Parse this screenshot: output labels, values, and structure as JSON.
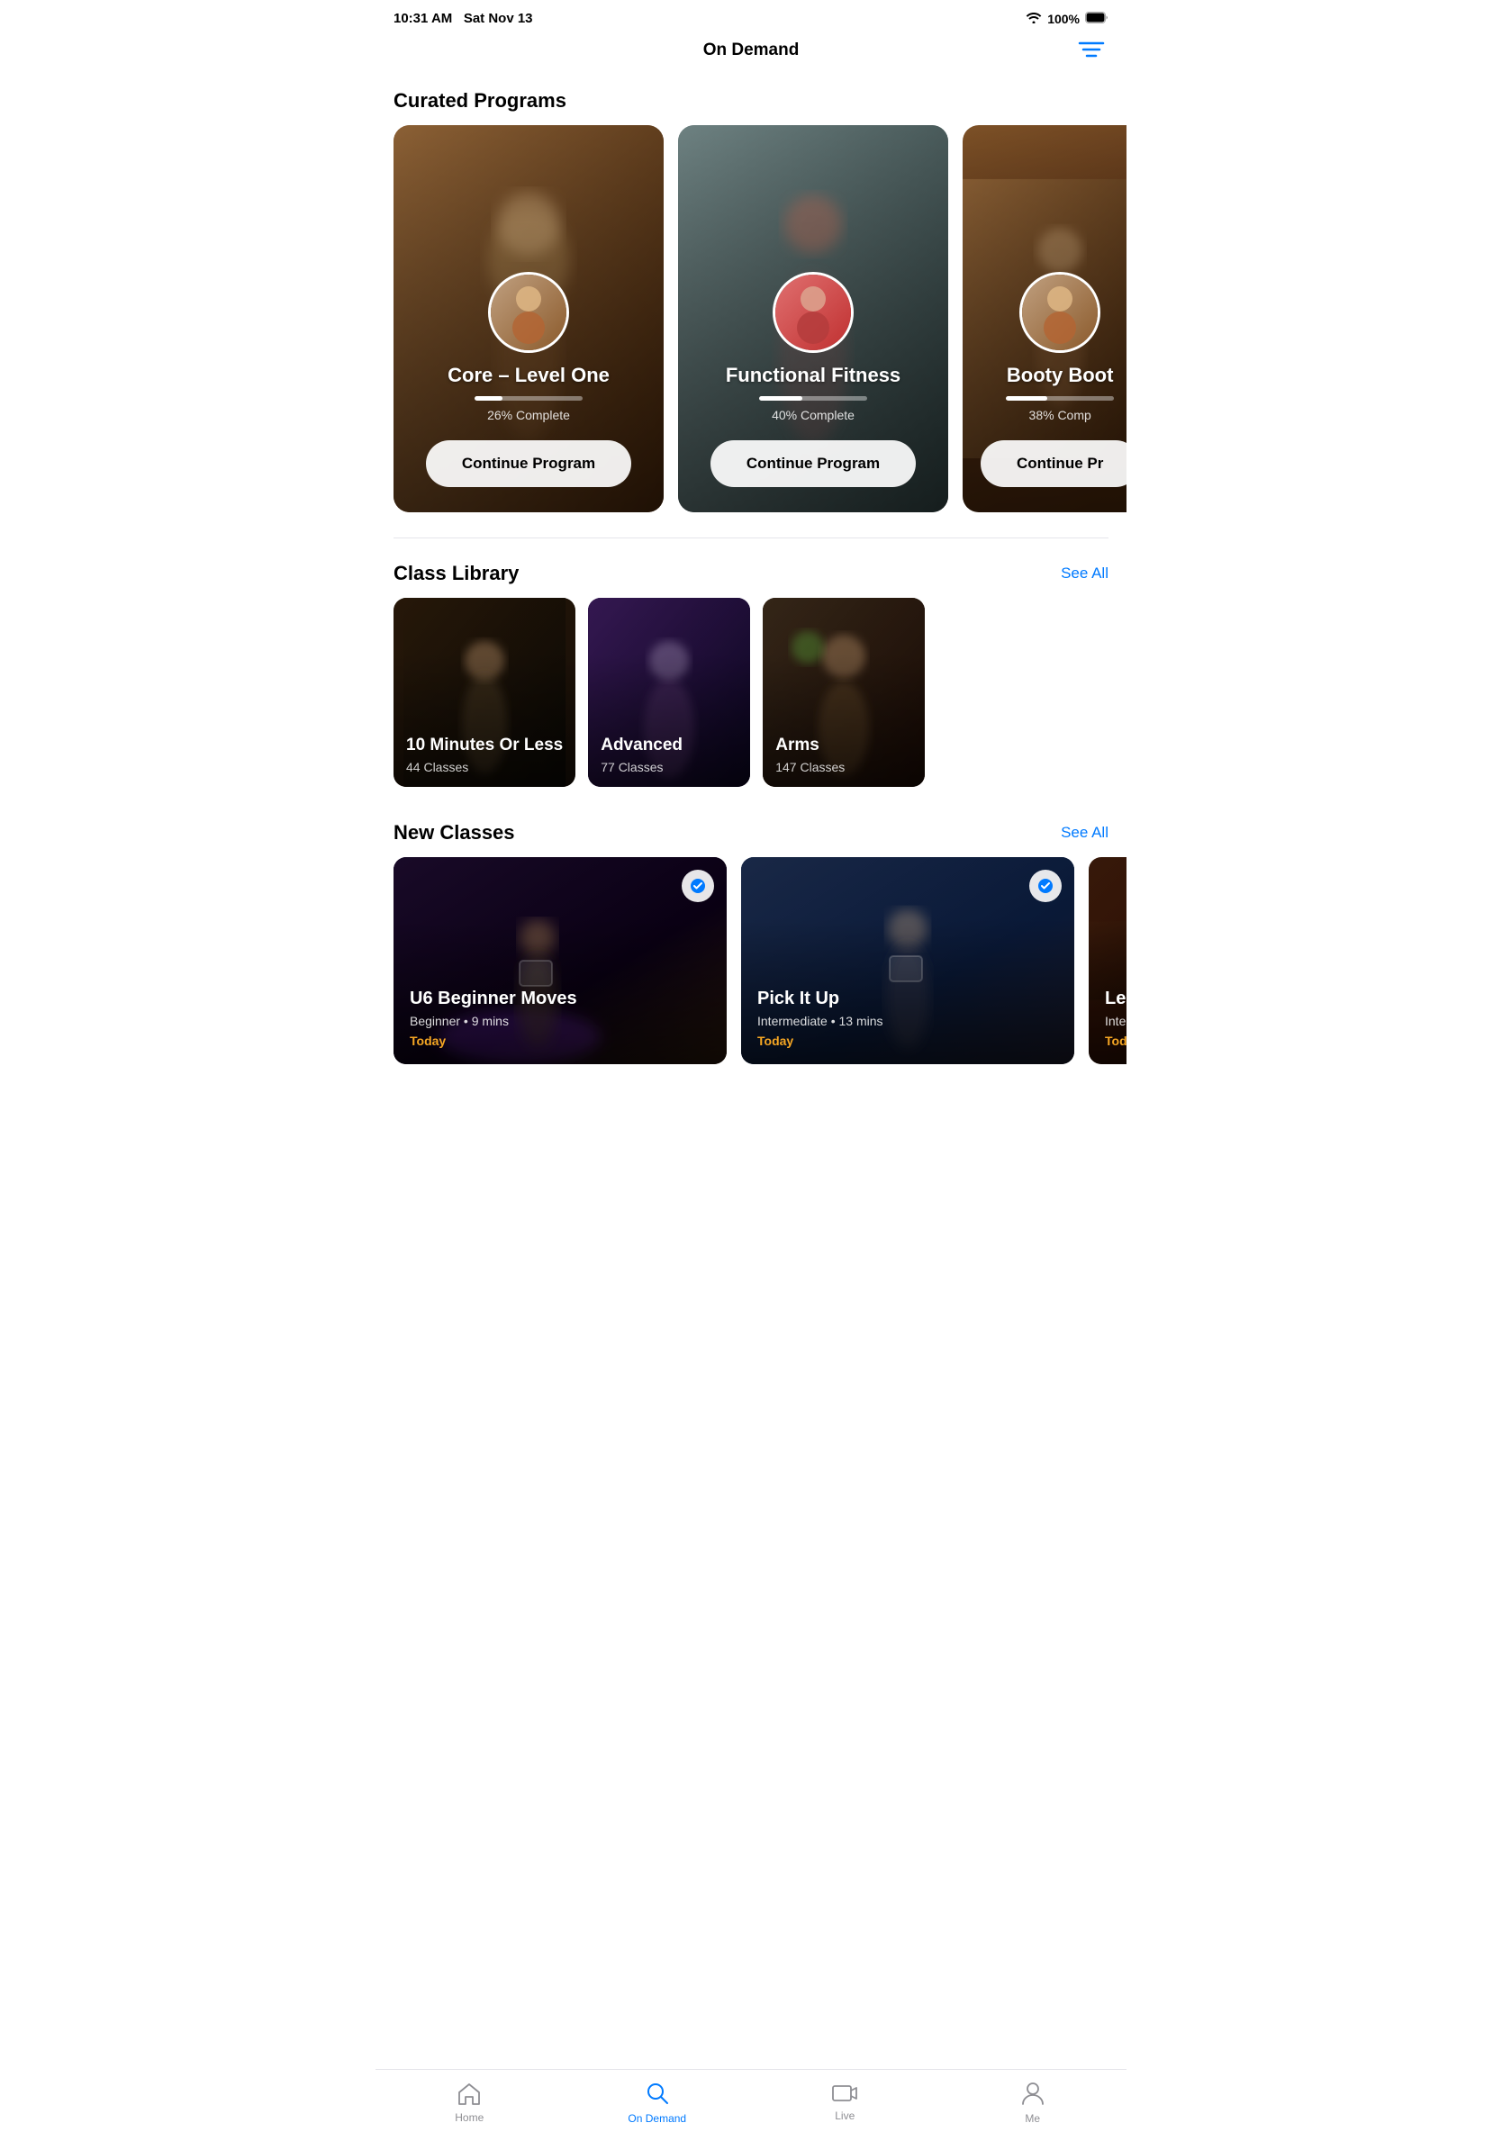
{
  "statusBar": {
    "time": "10:31 AM",
    "date": "Sat Nov 13",
    "battery": "100%"
  },
  "header": {
    "title": "On Demand",
    "filterLabel": "Filter"
  },
  "curatedPrograms": {
    "sectionTitle": "Curated Programs",
    "programs": [
      {
        "id": "core-level-one",
        "name": "Core – Level One",
        "progress": 26,
        "progressText": "26% Complete",
        "buttonLabel": "Continue Program",
        "bgClass": "program-card-bg-core"
      },
      {
        "id": "functional-fitness",
        "name": "Functional Fitness",
        "progress": 40,
        "progressText": "40% Complete",
        "buttonLabel": "Continue Program",
        "bgClass": "program-card-bg-functional"
      },
      {
        "id": "booty-boot",
        "name": "Booty Boot",
        "progress": 38,
        "progressText": "38% Comp",
        "buttonLabel": "Continue Pr",
        "bgClass": "program-card-bg-booty"
      }
    ]
  },
  "classLibrary": {
    "sectionTitle": "Class Library",
    "seeAllLabel": "See All",
    "categories": [
      {
        "id": "10-minutes-or-less",
        "name": "10 Minutes Or Less",
        "count": "44 Classes",
        "bgClass": "library-card-bg-10min"
      },
      {
        "id": "advanced",
        "name": "Advanced",
        "count": "77 Classes",
        "bgClass": "library-card-bg-advanced"
      },
      {
        "id": "arms",
        "name": "Arms",
        "count": "147 Classes",
        "bgClass": "library-card-bg-arms"
      }
    ]
  },
  "newClasses": {
    "sectionTitle": "New Classes",
    "seeAllLabel": "See All",
    "classes": [
      {
        "id": "u6-beginner-moves",
        "name": "U6 Beginner Moves",
        "level": "Beginner",
        "duration": "9 mins",
        "date": "Today",
        "checked": true,
        "bgClass": "new-class-bg-u6"
      },
      {
        "id": "pick-it-up",
        "name": "Pick It Up",
        "level": "Intermediate",
        "duration": "13 mins",
        "date": "Today",
        "checked": true,
        "bgClass": "new-class-bg-pickup"
      },
      {
        "id": "legs",
        "name": "Legs &",
        "level": "Interme",
        "duration": "",
        "date": "Today",
        "checked": false,
        "bgClass": "new-class-bg-legs"
      }
    ]
  },
  "bottomNav": {
    "items": [
      {
        "id": "home",
        "label": "Home",
        "active": false
      },
      {
        "id": "on-demand",
        "label": "On Demand",
        "active": true
      },
      {
        "id": "live",
        "label": "Live",
        "active": false
      },
      {
        "id": "me",
        "label": "Me",
        "active": false
      }
    ]
  }
}
